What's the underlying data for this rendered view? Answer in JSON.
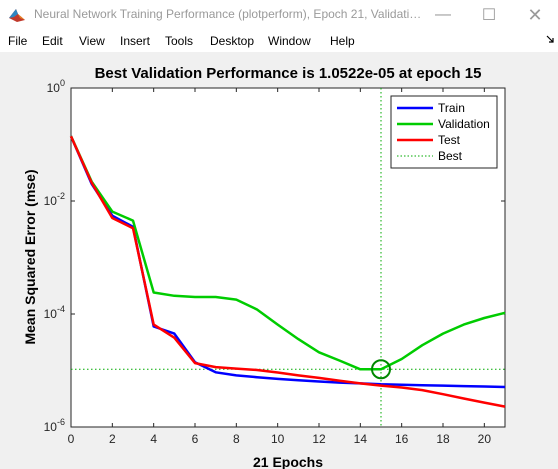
{
  "window": {
    "title": "Neural Network Training Performance (plotperform), Epoch 21, Validatio...",
    "minimize_glyph": "—",
    "maximize_glyph": "☐",
    "close_glyph": "✕"
  },
  "menu": {
    "items": [
      "File",
      "Edit",
      "View",
      "Insert",
      "Tools",
      "Desktop",
      "Window",
      "Help"
    ]
  },
  "icons": {
    "app": "matlab-icon",
    "dock": "dock-arrow-icon"
  },
  "colors": {
    "train": "#0000ff",
    "validation": "#00cc00",
    "test": "#ff0000",
    "best": "#00aa00"
  },
  "chart_data": {
    "type": "line",
    "title": "Best Validation Performance is 1.0522e-05 at epoch 15",
    "xlabel": "21 Epochs",
    "ylabel": "Mean Squared Error  (mse)",
    "y_scale": "log",
    "xlim": [
      0,
      21
    ],
    "ylim": [
      1e-06,
      1
    ],
    "x_ticks": [
      0,
      2,
      4,
      6,
      8,
      10,
      12,
      14,
      16,
      18,
      20
    ],
    "y_ticks": [
      {
        "value": 1,
        "base": "10",
        "exp": "0"
      },
      {
        "value": 0.01,
        "base": "10",
        "exp": "-2"
      },
      {
        "value": 0.0001,
        "base": "10",
        "exp": "-4"
      },
      {
        "value": 1e-06,
        "base": "10",
        "exp": "-6"
      }
    ],
    "grid": false,
    "legend_position": "top-right",
    "series": [
      {
        "name": "Train",
        "x": [
          0,
          1,
          2,
          3,
          4,
          5,
          6,
          7,
          8,
          9,
          10,
          11,
          12,
          13,
          14,
          15,
          16,
          17,
          18,
          19,
          20,
          21
        ],
        "y": [
          0.14,
          0.02,
          0.0055,
          0.0035,
          6e-05,
          4.5e-05,
          1.4e-05,
          9.3e-06,
          8.2e-06,
          7.6e-06,
          7.1e-06,
          6.7e-06,
          6.4e-06,
          6.1e-06,
          5.9e-06,
          5.7e-06,
          5.6e-06,
          5.5e-06,
          5.4e-06,
          5.3e-06,
          5.2e-06,
          5.1e-06
        ],
        "color": "#0000ff"
      },
      {
        "name": "Validation",
        "x": [
          0,
          1,
          2,
          3,
          4,
          5,
          6,
          7,
          8,
          9,
          10,
          11,
          12,
          13,
          14,
          15,
          16,
          17,
          18,
          19,
          20,
          21
        ],
        "y": [
          0.14,
          0.022,
          0.0065,
          0.0045,
          0.00024,
          0.00021,
          0.0002,
          0.0002,
          0.00018,
          0.00012,
          6.5e-05,
          3.6e-05,
          2.1e-05,
          1.5e-05,
          1.05e-05,
          1.05e-05,
          1.6e-05,
          2.8e-05,
          4.5e-05,
          6.5e-05,
          8.5e-05,
          0.000105
        ],
        "color": "#00cc00"
      },
      {
        "name": "Test",
        "x": [
          0,
          1,
          2,
          3,
          4,
          5,
          6,
          7,
          8,
          9,
          10,
          11,
          12,
          13,
          14,
          15,
          16,
          17,
          18,
          19,
          20,
          21
        ],
        "y": [
          0.14,
          0.021,
          0.005,
          0.0033,
          6.5e-05,
          3.8e-05,
          1.35e-05,
          1.15e-05,
          1.08e-05,
          1.02e-05,
          9.2e-06,
          8.2e-06,
          7.4e-06,
          6.6e-06,
          5.9e-06,
          5.4e-06,
          5e-06,
          4.5e-06,
          3.8e-06,
          3.2e-06,
          2.7e-06,
          2.3e-06
        ],
        "color": "#ff0000"
      },
      {
        "name": "Best",
        "style": "dotted",
        "color": "#00aa00",
        "best_epoch": 15,
        "best_value": 1.0522e-05
      }
    ]
  }
}
